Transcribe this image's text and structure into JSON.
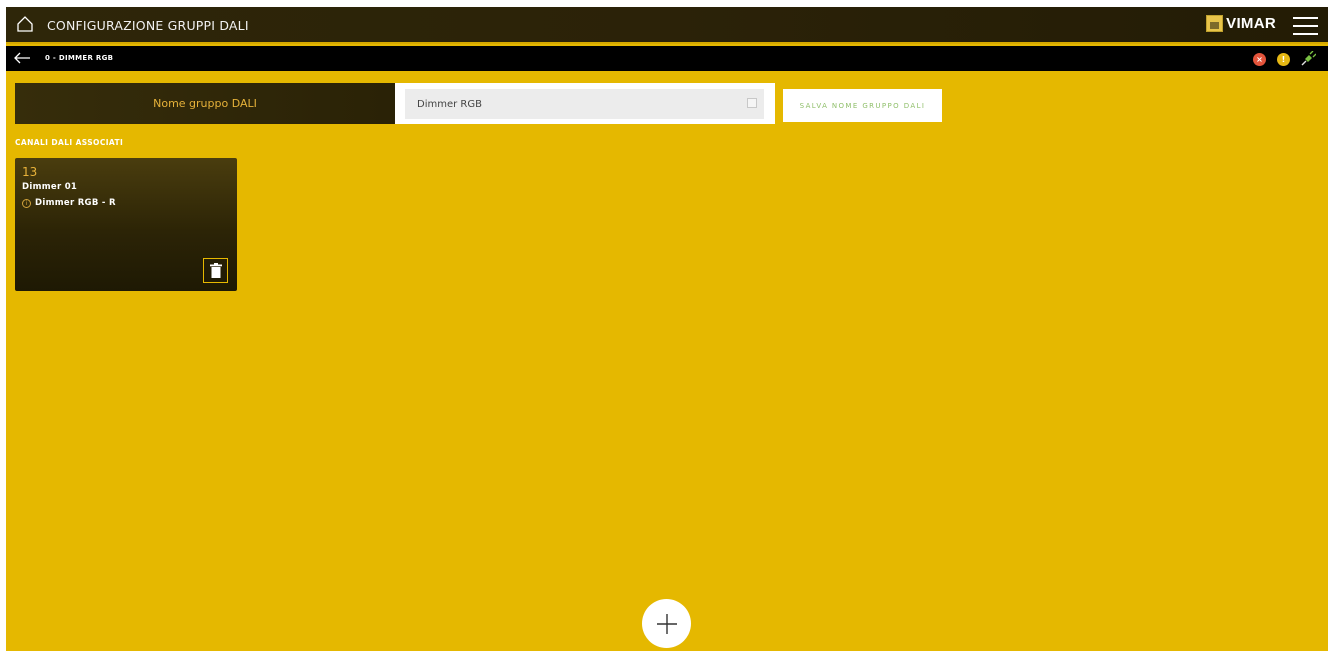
{
  "header": {
    "title": "CONFIGURAZIONE GRUPPI DALI",
    "brand": "VIMAR",
    "home_icon": "home-icon",
    "menu_icon": "hamburger-menu-icon"
  },
  "subheader": {
    "page_name": "0 - DIMMER RGB",
    "back_icon": "arrow-left-icon",
    "status_icons": [
      "error-icon",
      "warning-icon",
      "plug-icon"
    ],
    "colors": {
      "error": "#e4543b",
      "warning": "#e6b814",
      "plug": "#7ac143"
    }
  },
  "form": {
    "name_label": "Nome gruppo DALI",
    "name_value": "Dimmer RGB",
    "save_label": "SALVA NOME GRUPPO DALI"
  },
  "channels": {
    "section_title": "CANALI DALI ASSOCIATI",
    "items": [
      {
        "number": "13",
        "name": "Dimmer 01",
        "group": "Dimmer RGB - R"
      }
    ]
  },
  "colors": {
    "background": "#e5b800",
    "header": "#2b2208",
    "accent": "#e6b23a"
  }
}
